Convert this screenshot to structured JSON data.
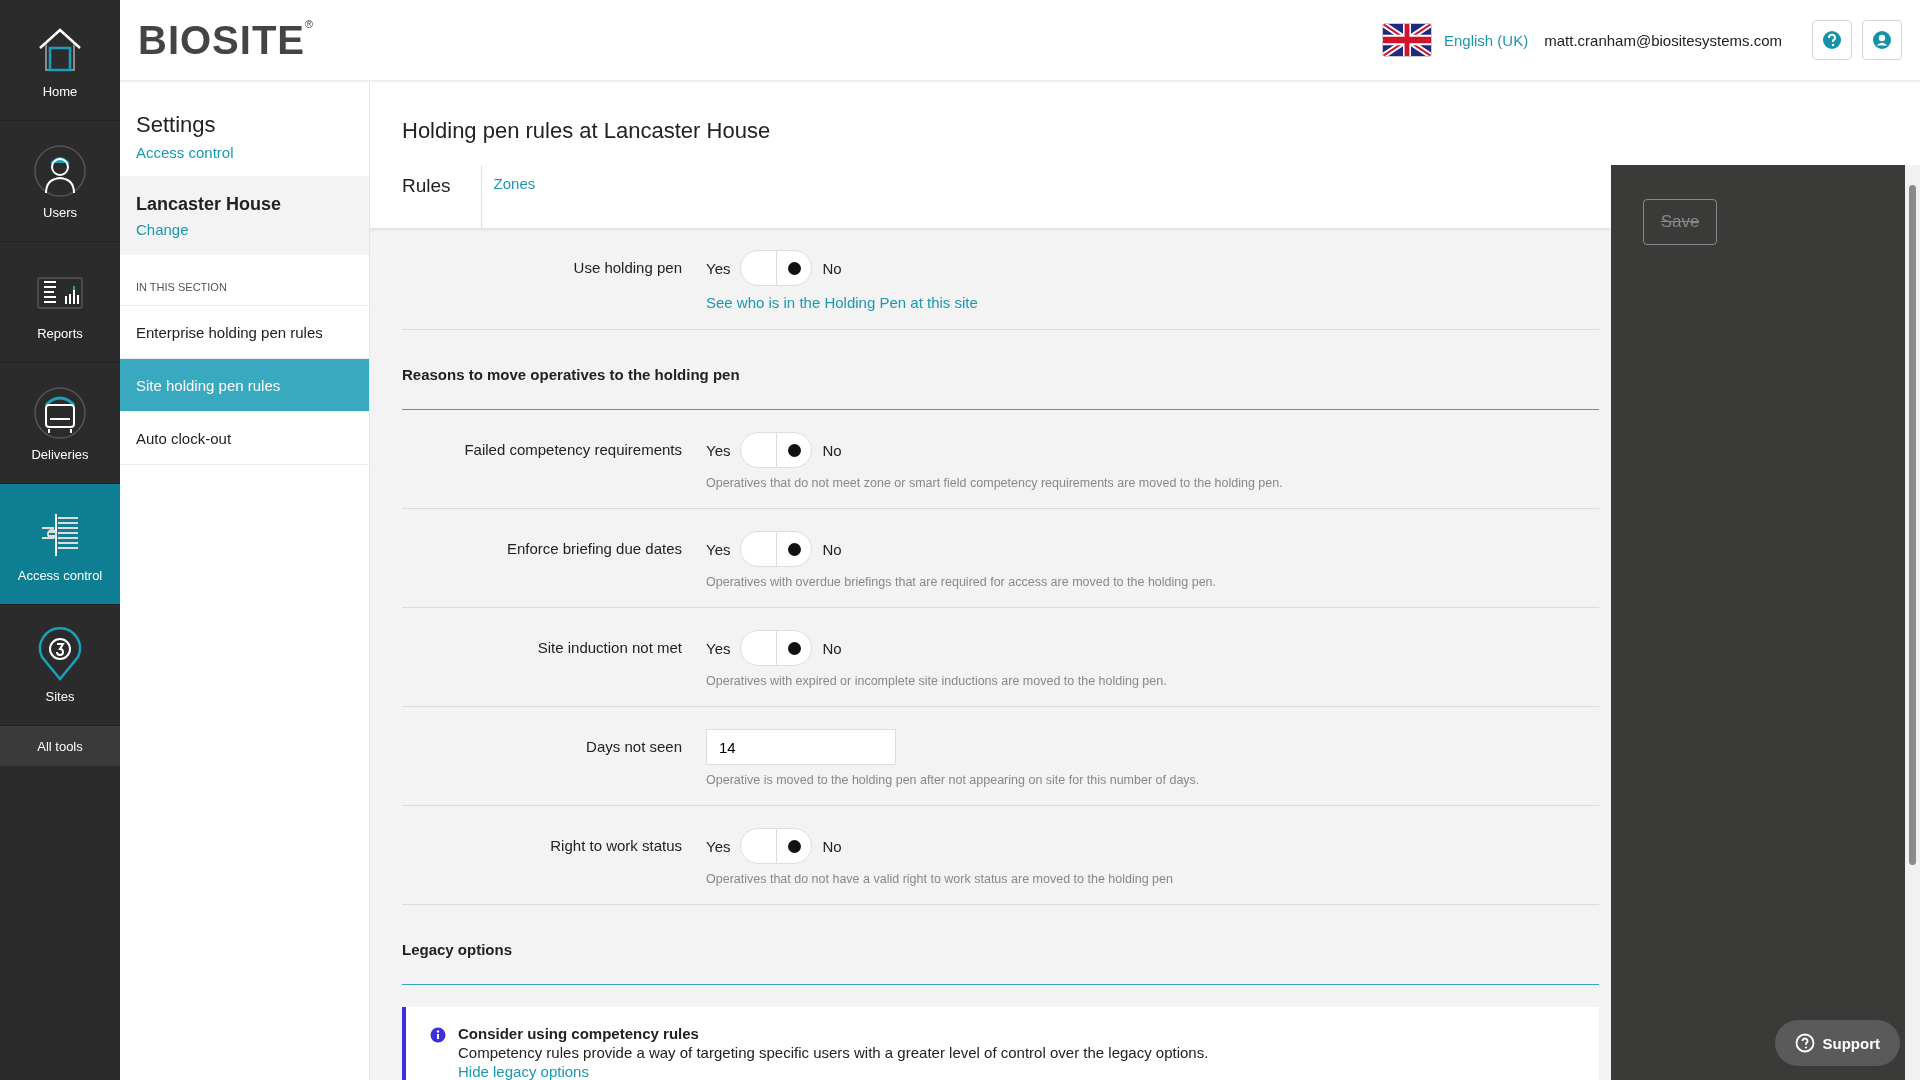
{
  "nav": {
    "items": [
      {
        "label": "Home",
        "selected": false
      },
      {
        "label": "Users",
        "selected": false
      },
      {
        "label": "Reports",
        "selected": false
      },
      {
        "label": "Deliveries",
        "selected": false
      },
      {
        "label": "Access control",
        "selected": true
      },
      {
        "label": "Sites",
        "selected": false
      }
    ],
    "all_tools": "All tools"
  },
  "header": {
    "logo": "BIOSITE$^{®}$",
    "language": "English (UK)",
    "email": "matt.cranham@biositesystems.com"
  },
  "sidebar": {
    "title": "Settings",
    "subtitle": "Access control",
    "site": "Lancaster House",
    "change": "Change",
    "section_label": "IN THIS SECTION",
    "items": [
      {
        "label": "Enterprise holding pen rules",
        "selected": false
      },
      {
        "label": "Site holding pen rules",
        "selected": true
      },
      {
        "label": "Auto clock-out",
        "selected": false
      }
    ]
  },
  "page": {
    "title": "Holding pen rules at Lancaster House",
    "tabs": [
      {
        "label": "Rules",
        "selected": true
      },
      {
        "label": "Zones",
        "selected": false
      }
    ],
    "save": {
      "label": "Save",
      "disabled": true
    }
  },
  "form": {
    "rows": [
      {
        "kind": "toggle",
        "label": "Use holding pen",
        "yes": "Yes",
        "no": "No",
        "no_selected": true,
        "link": "See who is in the Holding Pen at this site"
      },
      {
        "kind": "heading",
        "label": "Reasons to move operatives to the holding pen"
      },
      {
        "kind": "toggle",
        "label": "Failed competency requirements",
        "yes": "Yes",
        "no": "No",
        "no_selected": true,
        "help": "Operatives that do not meet zone or smart field competency requirements are moved to the holding pen."
      },
      {
        "kind": "toggle",
        "label": "Enforce briefing due dates",
        "yes": "Yes",
        "no": "No",
        "no_selected": true,
        "help": "Operatives with overdue briefings that are required for access are moved to the holding pen."
      },
      {
        "kind": "toggle",
        "label": "Site induction not met",
        "yes": "Yes",
        "no": "No",
        "no_selected": true,
        "help": "Operatives with expired or incomplete site inductions are moved to the holding pen."
      },
      {
        "kind": "number",
        "label": "Days not seen",
        "value": "14",
        "help": "Operative is moved to the holding pen after not appearing on site for this number of days."
      },
      {
        "kind": "toggle",
        "label": "Right to work status",
        "yes": "Yes",
        "no": "No",
        "no_selected": true,
        "help": "Operatives that do not have a valid right to work status are moved to the holding pen"
      },
      {
        "kind": "heading",
        "label": "Legacy options"
      },
      {
        "kind": "info",
        "title": "Consider using competency rules",
        "text": "Competency rules provide a way of targeting specific users with a greater level of control over the legacy options.",
        "link": "Hide legacy options"
      }
    ]
  },
  "support": "Support"
}
